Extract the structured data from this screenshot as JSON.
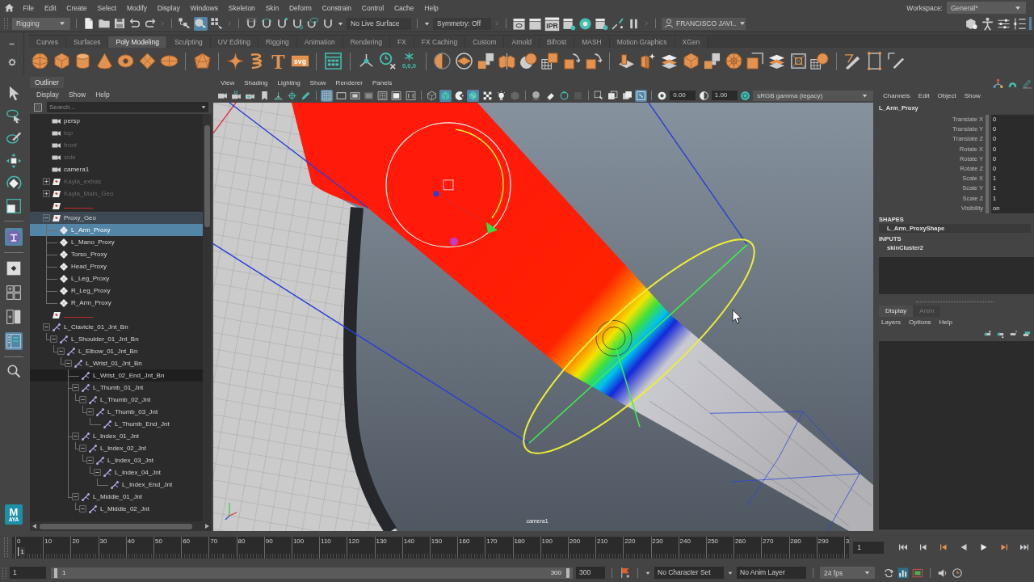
{
  "menu_bar": {
    "items": [
      "File",
      "Edit",
      "Create",
      "Select",
      "Modify",
      "Display",
      "Windows",
      "Skeleton",
      "Skin",
      "Deform",
      "Constrain",
      "Control",
      "Cache",
      "Help"
    ],
    "workspace_label": "Workspace:",
    "workspace": "General*"
  },
  "status_line": {
    "menu_set": "Rigging",
    "select_modes": [
      {
        "on": false
      },
      {
        "on": true
      },
      {
        "on": false
      }
    ],
    "live_surface": "No Live Surface",
    "symmetry": "Symmetry: Off",
    "ipr_label": "IPR",
    "user": "FRANCISCO JAVI.."
  },
  "shelf": {
    "tabs": [
      {
        "label": "Curves",
        "selected": false
      },
      {
        "label": "Surfaces",
        "selected": false
      },
      {
        "label": "Poly Modeling",
        "selected": true
      },
      {
        "label": "Sculpting",
        "selected": false
      },
      {
        "label": "UV Editing",
        "selected": false
      },
      {
        "label": "Rigging",
        "selected": false
      },
      {
        "label": "Animation",
        "selected": false
      },
      {
        "label": "Rendering",
        "selected": false
      },
      {
        "label": "FX",
        "selected": false
      },
      {
        "label": "FX Caching",
        "selected": false
      },
      {
        "label": "Custom",
        "selected": false
      },
      {
        "label": "Arnold",
        "selected": false
      },
      {
        "label": "Bifrost",
        "selected": false
      },
      {
        "label": "MASH",
        "selected": false
      },
      {
        "label": "Motion Graphics",
        "selected": false
      },
      {
        "label": "XGen",
        "selected": false
      }
    ],
    "text_icons": [
      "T",
      "svg",
      "0,0,0"
    ]
  },
  "toolbox": {
    "panel_buttons": [
      {
        "on": true
      },
      {
        "on": false
      },
      {
        "on": false
      },
      {
        "on": false
      },
      {
        "on": true
      }
    ],
    "logo_letter": "M",
    "logo_caption": "AYA"
  },
  "outliner": {
    "title": "Outliner",
    "menus": [
      "Display",
      "Show",
      "Help"
    ],
    "search_placeholder": "Search...",
    "items": [
      {
        "label": "persp",
        "kind": "camera",
        "selected": false,
        "dimmed": false,
        "highlighted": false,
        "hovered": false
      },
      {
        "label": "top",
        "kind": "camera",
        "selected": false,
        "dimmed": true,
        "highlighted": false,
        "hovered": false
      },
      {
        "label": "front",
        "kind": "camera",
        "selected": false,
        "dimmed": true,
        "highlighted": false,
        "hovered": false
      },
      {
        "label": "side",
        "kind": "camera",
        "selected": false,
        "dimmed": true,
        "highlighted": false,
        "hovered": false
      },
      {
        "label": "camera1",
        "kind": "camera",
        "selected": false,
        "dimmed": false,
        "highlighted": false,
        "hovered": false
      },
      {
        "label": "Kayla_extras",
        "kind": "set",
        "selected": false,
        "dimmed": true,
        "highlighted": false,
        "hovered": false,
        "expanded": false
      },
      {
        "label": "Kayla_Main_Geo",
        "kind": "set",
        "selected": false,
        "dimmed": true,
        "highlighted": false,
        "hovered": false,
        "expanded": false
      },
      {
        "kind": "divider-set",
        "selected": false,
        "highlighted": false,
        "hovered": false
      },
      {
        "label": "Proxy_Geo",
        "kind": "set",
        "selected": false,
        "dimmed": false,
        "highlighted": true,
        "hovered": false,
        "expanded": true,
        "children": [
          {
            "label": "L_Arm_Proxy",
            "kind": "mesh",
            "selected": true,
            "dimmed": false,
            "highlighted": false,
            "hovered": false
          },
          {
            "label": "L_Mano_Proxy",
            "kind": "mesh",
            "selected": false,
            "dimmed": false,
            "highlighted": false,
            "hovered": false
          },
          {
            "label": "Torso_Proxy",
            "kind": "mesh",
            "selected": false,
            "dimmed": false,
            "highlighted": false,
            "hovered": false
          },
          {
            "label": "Head_Proxy",
            "kind": "mesh",
            "selected": false,
            "dimmed": false,
            "highlighted": false,
            "hovered": false
          },
          {
            "label": "L_Leg_Proxy",
            "kind": "mesh",
            "selected": false,
            "dimmed": false,
            "highlighted": false,
            "hovered": false
          },
          {
            "label": "R_Leg_Proxy",
            "kind": "mesh",
            "selected": false,
            "dimmed": false,
            "highlighted": false,
            "hovered": false
          },
          {
            "label": "R_Arm_Proxy",
            "kind": "mesh",
            "selected": false,
            "dimmed": false,
            "highlighted": false,
            "hovered": false
          }
        ]
      },
      {
        "kind": "divider-set",
        "selected": false,
        "highlighted": false,
        "hovered": false
      },
      {
        "label": "L_Clavicle_01_Jnt_Bn",
        "kind": "joint",
        "selected": false,
        "dimmed": false,
        "highlighted": false,
        "hovered": false,
        "expanded": true,
        "children": [
          {
            "label": "L_Shoulder_01_Jnt_Bn",
            "kind": "joint",
            "selected": false,
            "dimmed": false,
            "highlighted": false,
            "hovered": false,
            "expanded": true,
            "children": [
              {
                "label": "L_Elbow_01_Jnt_Bn",
                "kind": "joint",
                "selected": false,
                "dimmed": false,
                "highlighted": false,
                "hovered": false,
                "expanded": true,
                "children": [
                  {
                    "label": "L_Wrist_01_Jnt_Bn",
                    "kind": "joint",
                    "selected": false,
                    "dimmed": false,
                    "highlighted": false,
                    "hovered": false,
                    "expanded": true,
                    "children": [
                      {
                        "label": "L_Wrist_02_End_Jnt_Bn",
                        "kind": "joint",
                        "selected": false,
                        "dimmed": false,
                        "highlighted": false,
                        "hovered": true
                      },
                      {
                        "label": "L_Thumb_01_Jnt",
                        "kind": "joint",
                        "selected": false,
                        "dimmed": false,
                        "highlighted": false,
                        "hovered": false,
                        "expanded": true,
                        "children": [
                          {
                            "label": "L_Thumb_02_Jnt",
                            "kind": "joint",
                            "selected": false,
                            "dimmed": false,
                            "highlighted": false,
                            "hovered": false,
                            "expanded": true,
                            "children": [
                              {
                                "label": "L_Thumb_03_Jnt",
                                "kind": "joint",
                                "selected": false,
                                "dimmed": false,
                                "highlighted": false,
                                "hovered": false,
                                "expanded": true,
                                "children": [
                                  {
                                    "label": "L_Thumb_End_Jnt",
                                    "kind": "joint",
                                    "selected": false,
                                    "dimmed": false,
                                    "highlighted": false,
                                    "hovered": false
                                  }
                                ]
                              }
                            ]
                          }
                        ]
                      },
                      {
                        "label": "L_Index_01_Jnt",
                        "kind": "joint",
                        "selected": false,
                        "dimmed": false,
                        "highlighted": false,
                        "hovered": false,
                        "expanded": true,
                        "children": [
                          {
                            "label": "L_Index_02_Jnt",
                            "kind": "joint",
                            "selected": false,
                            "dimmed": false,
                            "highlighted": false,
                            "hovered": false,
                            "expanded": true,
                            "children": [
                              {
                                "label": "L_Index_03_Jnt",
                                "kind": "joint",
                                "selected": false,
                                "dimmed": false,
                                "highlighted": false,
                                "hovered": false,
                                "expanded": true,
                                "children": [
                                  {
                                    "label": "L_Index_04_Jnt",
                                    "kind": "joint",
                                    "selected": false,
                                    "dimmed": false,
                                    "highlighted": false,
                                    "hovered": false,
                                    "expanded": true,
                                    "children": [
                                      {
                                        "label": "L_Index_End_Jnt",
                                        "kind": "joint",
                                        "selected": false,
                                        "dimmed": false,
                                        "highlighted": false,
                                        "hovered": false
                                      }
                                    ]
                                  }
                                ]
                              }
                            ]
                          }
                        ]
                      },
                      {
                        "label": "L_Middle_01_Jnt",
                        "kind": "joint",
                        "selected": false,
                        "dimmed": false,
                        "highlighted": false,
                        "hovered": false,
                        "expanded": true,
                        "children": [
                          {
                            "label": "L_Middle_02_Jnt",
                            "kind": "joint",
                            "selected": false,
                            "dimmed": false,
                            "highlighted": false,
                            "hovered": false,
                            "expanded": true
                          }
                        ]
                      }
                    ]
                  }
                ]
              }
            ]
          }
        ]
      }
    ]
  },
  "viewport": {
    "menus": [
      "View",
      "Shading",
      "Lighting",
      "Show",
      "Renderer",
      "Panels"
    ],
    "toolbar": [
      {
        "on": false
      },
      {
        "on": false
      },
      {
        "on": false
      },
      {
        "on": false
      },
      {
        "on": false
      },
      {
        "on": false
      },
      {
        "on": false
      },
      {
        "on": true
      },
      {
        "on": false
      },
      {
        "on": false
      },
      {
        "on": false
      },
      {
        "on": false
      },
      {
        "on": false
      },
      {
        "on": false
      },
      {
        "on": false
      },
      {
        "on": true
      },
      {
        "on": false
      },
      {
        "on": true
      },
      {
        "on": false
      },
      {
        "on": false
      },
      {
        "on": false
      },
      {
        "on": false
      },
      {
        "on": false
      },
      {
        "on": false
      },
      {
        "on": false
      },
      {
        "on": false
      },
      {
        "on": false
      },
      {
        "on": false
      },
      {
        "on": true
      }
    ],
    "exposure": "0.00",
    "gamma": "1.00",
    "color_space": "sRGB gamma (legacy)",
    "camera_label": "camera1"
  },
  "channel_box": {
    "menus": [
      "Channels",
      "Edit",
      "Object",
      "Show"
    ],
    "object": "L_Arm_Proxy",
    "attributes": [
      {
        "label": "Translate X",
        "value": "0"
      },
      {
        "label": "Translate Y",
        "value": "0"
      },
      {
        "label": "Translate Z",
        "value": "0"
      },
      {
        "label": "Rotate X",
        "value": "0"
      },
      {
        "label": "Rotate Y",
        "value": "0"
      },
      {
        "label": "Rotate Z",
        "value": "0"
      },
      {
        "label": "Scale X",
        "value": "1"
      },
      {
        "label": "Scale Y",
        "value": "1"
      },
      {
        "label": "Scale Z",
        "value": "1"
      },
      {
        "label": "Visibility",
        "value": "on"
      }
    ],
    "shapes_header": "SHAPES",
    "shape": "L_Arm_ProxyShape",
    "inputs_header": "INPUTS",
    "input": "skinCluster2"
  },
  "layer_editor": {
    "tabs": [
      {
        "label": "Display",
        "selected": true
      },
      {
        "label": "Anim",
        "selected": false
      }
    ],
    "menus": [
      "Layers",
      "Options",
      "Help"
    ]
  },
  "time_slider": {
    "ticks": [
      "0",
      "10",
      "20",
      "30",
      "40",
      "50",
      "60",
      "70",
      "80",
      "90",
      "100",
      "110",
      "120",
      "130",
      "140",
      "150",
      "160",
      "170",
      "180",
      "190",
      "200",
      "210",
      "220",
      "230",
      "240",
      "250",
      "260",
      "270",
      "280",
      "290",
      "3"
    ],
    "level": 0.0033,
    "current_frame_marker": "1",
    "current_frame": "1"
  },
  "range_slider": {
    "start": "1",
    "level": 1,
    "range_start": "1",
    "range_end": "300",
    "end": "300",
    "character_set": "No Character Set",
    "anim_layer": "No Anim Layer",
    "fps": "24 fps"
  }
}
